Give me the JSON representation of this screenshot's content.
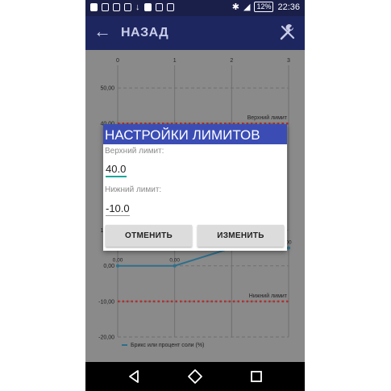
{
  "status_bar": {
    "battery": "12%",
    "time": "22:36"
  },
  "app_bar": {
    "back_icon": "arrow-left-icon",
    "title": "НАЗАД",
    "tools_icon": "tools-icon"
  },
  "chart_data": {
    "type": "line",
    "x_ticks": [
      "0",
      "1",
      "2",
      "3"
    ],
    "y_ticks": [
      "50,00",
      "40,00",
      "10,00",
      "0,00",
      "-10,00",
      "-20,00"
    ],
    "upper_limit_label": "Верхний лимит",
    "lower_limit_label": "Нижний лимит",
    "upper_limit": 40,
    "lower_limit": -10,
    "series": [
      {
        "name": "Брикс или процент соли (%)",
        "x": [
          0,
          1,
          2,
          3
        ],
        "y": [
          0,
          0,
          5,
          5
        ],
        "point_labels": [
          "0,00",
          "0,00",
          "",
          "00"
        ]
      }
    ],
    "xlim": [
      0,
      3
    ],
    "ylim": [
      -20,
      55
    ],
    "colors": {
      "series": "#2e6f8a",
      "limit": "#b03030",
      "grid": "#6f6f6f"
    }
  },
  "dialog": {
    "title": "НАСТРОЙКИ ЛИМИТОВ",
    "upper_label": "Верхний лимит:",
    "upper_value": "40.0",
    "lower_label": "Нижний лимит:",
    "lower_value": "-10.0",
    "cancel_label": "ОТМЕНИТЬ",
    "apply_label": "ИЗМЕНИТЬ",
    "accent": "#1aa79a"
  },
  "nav_bar": {
    "back": "nav-back-icon",
    "home": "nav-home-icon",
    "recents": "nav-recents-icon"
  }
}
